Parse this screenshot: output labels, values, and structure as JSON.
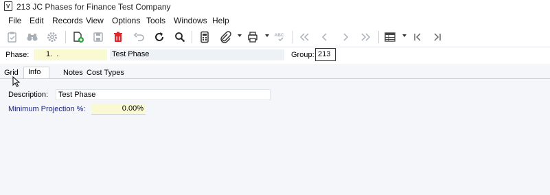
{
  "window": {
    "title": "213 JC Phases for Finance Test Company",
    "app_icon_letter": "V"
  },
  "menu": [
    "File",
    "Edit",
    "Records",
    "View",
    "Options",
    "Tools",
    "Windows",
    "Help"
  ],
  "toolbar": {
    "icons": [
      "clipboard-check-icon",
      "binoculars-icon",
      "gear-icon",
      "new-record-icon",
      "save-icon",
      "delete-icon",
      "undo-icon",
      "refresh-icon",
      "search-icon",
      "calculator-icon",
      "attachment-icon",
      "print-icon",
      "spellcheck-icon",
      "first-record-icon",
      "previous-record-icon",
      "next-record-icon",
      "last-record-icon",
      "grid-view-icon",
      "first-page-icon",
      "last-page-icon"
    ],
    "spellcheck_text": "ABC"
  },
  "header": {
    "phase_label": "Phase:",
    "phase_value": "1.  .",
    "phase_description": "Test Phase",
    "group_label": "Group:",
    "group_value": "213"
  },
  "tabs": [
    "Grid",
    "Info",
    "Notes",
    "Cost Types"
  ],
  "active_tab": "Info",
  "info": {
    "description_label": "Description:",
    "description_value": "Test Phase",
    "min_projection_label": "Minimum Projection %:",
    "min_projection_value": "0.00%"
  },
  "colors": {
    "required_field": "#fafad2",
    "label_blue": "#1a237e",
    "delete_red": "#e0262a"
  }
}
